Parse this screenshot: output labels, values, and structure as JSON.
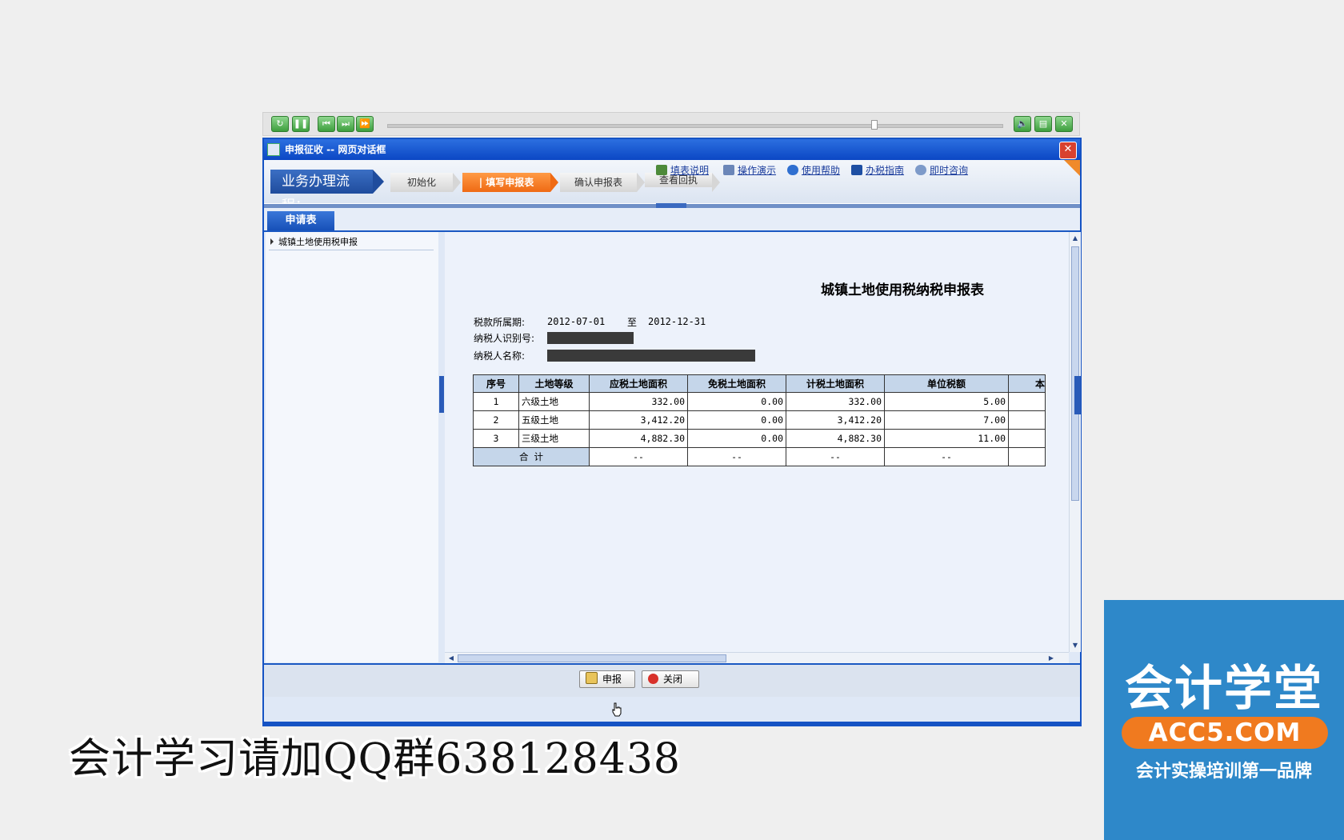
{
  "player": {
    "left_buttons": [
      "replay-icon",
      "pause-icon",
      "prev-icon",
      "next-icon",
      "fast-forward-icon"
    ],
    "right_buttons": [
      "volume-icon",
      "print-icon",
      "close-icon"
    ]
  },
  "dialog": {
    "title": "申报征收 -- 网页对话框",
    "close_glyph": "✕"
  },
  "process": {
    "label": "业务办理流程：",
    "steps": [
      "初始化",
      "| 填写申报表",
      "确认申报表",
      "查看回执"
    ],
    "active_step": 1
  },
  "links": [
    "填表说明",
    "操作演示",
    "使用帮助",
    "办税指南",
    "即时咨询"
  ],
  "tab": "申请表",
  "tree": {
    "item": "城镇土地使用税申报"
  },
  "form": {
    "title": "城镇土地使用税纳税申报表",
    "period_label": "税款所属期:",
    "period_from": "2012-07-01",
    "period_to_label": "至",
    "period_to": "2012-12-31",
    "taxpayer_id_label": "纳税人识别号:",
    "taxpayer_name_label": "纳税人名称:"
  },
  "table": {
    "headers": [
      "序号",
      "土地等级",
      "应税土地面积",
      "免税土地面积",
      "计税土地面积",
      "单位税额",
      "本"
    ],
    "rows": [
      [
        "1",
        "六级土地",
        "332.00",
        "0.00",
        "332.00",
        "5.00",
        ""
      ],
      [
        "2",
        "五级土地",
        "3,412.20",
        "0.00",
        "3,412.20",
        "7.00",
        ""
      ],
      [
        "3",
        "三级土地",
        "4,882.30",
        "0.00",
        "4,882.30",
        "11.00",
        ""
      ]
    ],
    "total_label": "合  计",
    "total_values": [
      "--",
      "--",
      "--",
      "--",
      ""
    ]
  },
  "buttons": {
    "submit": "申报",
    "close": "关闭"
  },
  "overlay": {
    "qq_text": "会计学习请加QQ群638128438",
    "brand_name": "会计学堂",
    "brand_url": "ACC5.COM",
    "brand_slogan": "会计实操培训第一品牌"
  },
  "colors": {
    "accent": "#1553c4",
    "active_step": "#ef6a14",
    "brand_bg": "#2e88c9",
    "brand_pill": "#f07a1f"
  }
}
